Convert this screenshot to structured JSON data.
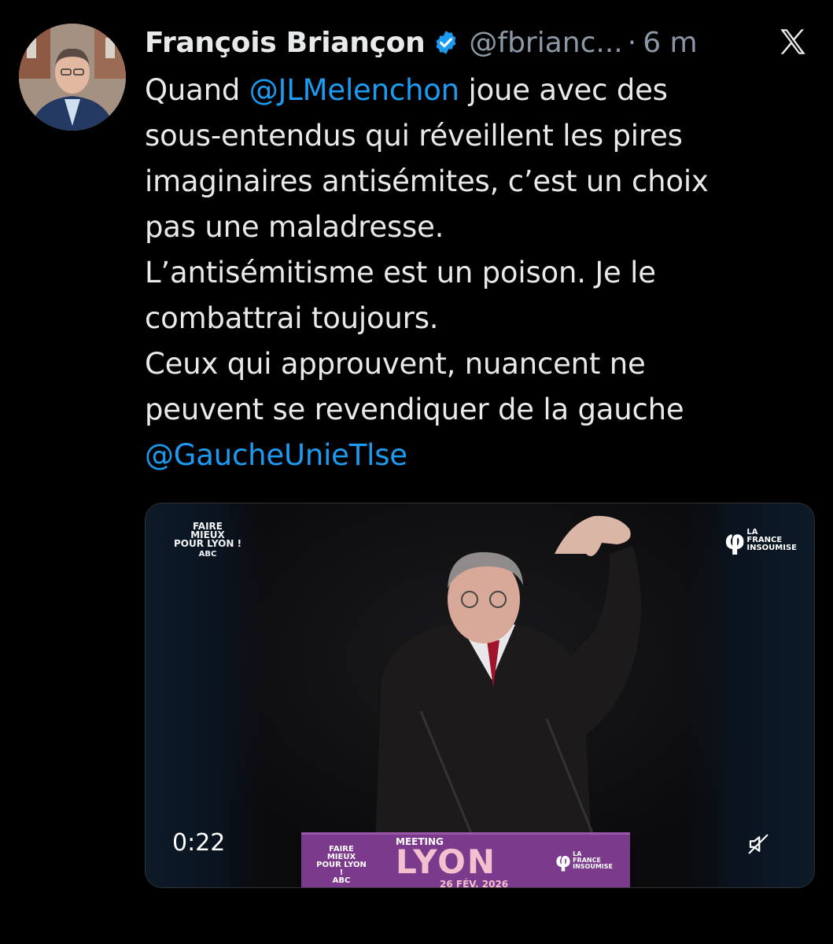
{
  "author": {
    "name": "François Briançon",
    "handle": "@fbrianc...",
    "separator": "·",
    "time": "6 m"
  },
  "tweet": {
    "lines": [
      {
        "prefix": "Quand ",
        "mention": "@JLMelenchon",
        "suffix": " joue avec des"
      },
      {
        "text": "sous-entendus qui réveillent les pires"
      },
      {
        "text": "imaginaires antisémites, c’est un choix"
      },
      {
        "text": "pas une maladresse."
      },
      {
        "text": "L’antisémitisme est un poison. Je le"
      },
      {
        "text": "combattrai toujours."
      },
      {
        "text": "Ceux qui approuvent, nuancent ne"
      },
      {
        "text": "peuvent se revendiquer de la gauche"
      },
      {
        "mention": "@GaucheUnieTlse"
      }
    ]
  },
  "media": {
    "duration": "0:22",
    "logo_lines": [
      "FAIRE",
      "MIEUX",
      "POUR LYON !",
      "ABC"
    ],
    "party_logo": {
      "symbol": "φ",
      "lines": [
        "LA",
        "FRANCE",
        "INSOUMISE"
      ]
    },
    "podium": {
      "left_lines": [
        "FAIRE",
        "MIEUX",
        "POUR LYON !",
        "ABC"
      ],
      "meeting": "MEETING",
      "city": "LYON",
      "date": "26 FÉV. 2026",
      "party_symbol": "φ",
      "party_lines": [
        "LA",
        "FRANCE",
        "INSOUMISE"
      ]
    }
  },
  "icons": {
    "verified": "verified-badge-icon",
    "x_logo": "x-logo-icon",
    "mute": "muted-speaker-icon"
  },
  "colors": {
    "background": "#000000",
    "text": "#e7e9ea",
    "secondary": "#8b98a5",
    "link": "#1d9bf0",
    "podium": "#7b3a8c",
    "podium_accent": "#f2c0cf"
  }
}
